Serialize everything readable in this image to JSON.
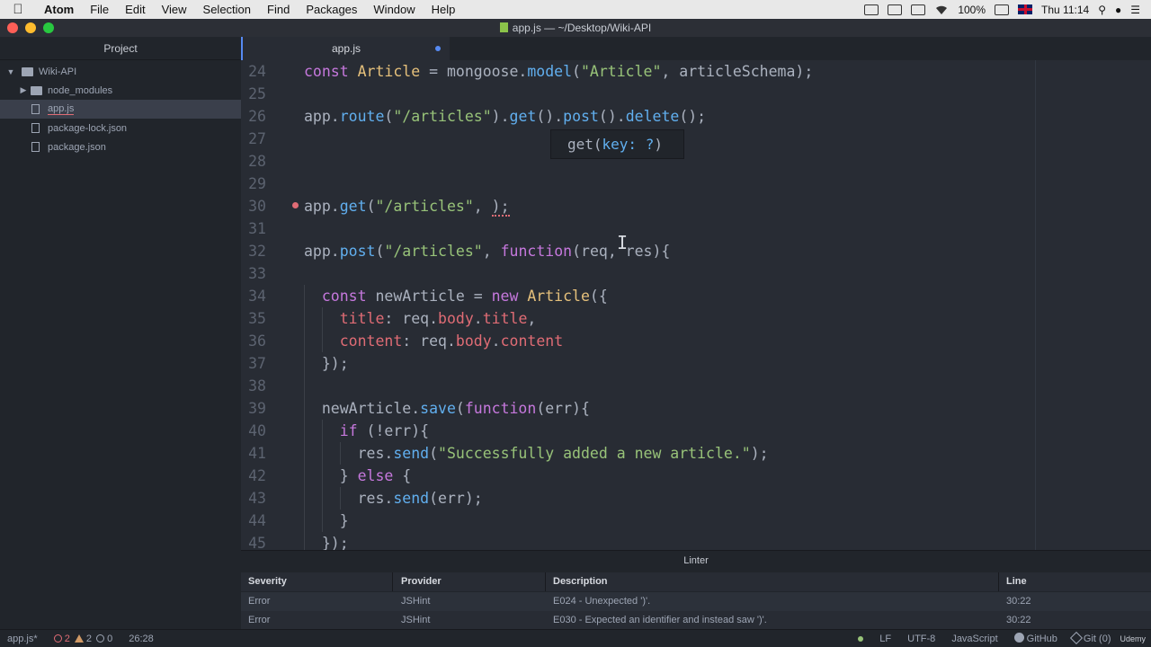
{
  "menubar": {
    "app": "Atom",
    "items": [
      "File",
      "Edit",
      "View",
      "Selection",
      "Find",
      "Packages",
      "Window",
      "Help"
    ],
    "battery": "100%",
    "clock": "Thu 11:14"
  },
  "window": {
    "title": "app.js — ~/Desktop/Wiki-API"
  },
  "sidebar": {
    "header": "Project",
    "root": "Wiki-API",
    "items": [
      "node_modules",
      "app.js",
      "package-lock.json",
      "package.json"
    ]
  },
  "tab": {
    "label": "app.js"
  },
  "editor": {
    "line_numbers": [
      "24",
      "25",
      "26",
      "27",
      "28",
      "29",
      "30",
      "31",
      "32",
      "33",
      "34",
      "35",
      "36",
      "37",
      "38",
      "39",
      "40",
      "41",
      "42",
      "43",
      "44",
      "45"
    ],
    "tooltip": {
      "prefix": "get(",
      "param": "key: ?",
      "suffix": ")"
    }
  },
  "linter": {
    "title": "Linter",
    "columns": [
      "Severity",
      "Provider",
      "Description",
      "Line"
    ],
    "rows": [
      [
        "Error",
        "JSHint",
        "E024 - Unexpected ')'.",
        "30:22"
      ],
      [
        "Error",
        "JSHint",
        "E030 - Expected an identifier and instead saw ')'.",
        "30:22"
      ]
    ]
  },
  "statusbar": {
    "file": "app.js*",
    "errors": "2",
    "warnings": "2",
    "infos": "0",
    "cursor": "26:28",
    "line_ending": "LF",
    "encoding": "UTF-8",
    "grammar": "JavaScript",
    "github": "GitHub",
    "git": "Git (0)",
    "watermark": "Udemy"
  },
  "colors": {
    "accent": "#568af2",
    "error": "#e06c75",
    "background": "#282c34"
  }
}
